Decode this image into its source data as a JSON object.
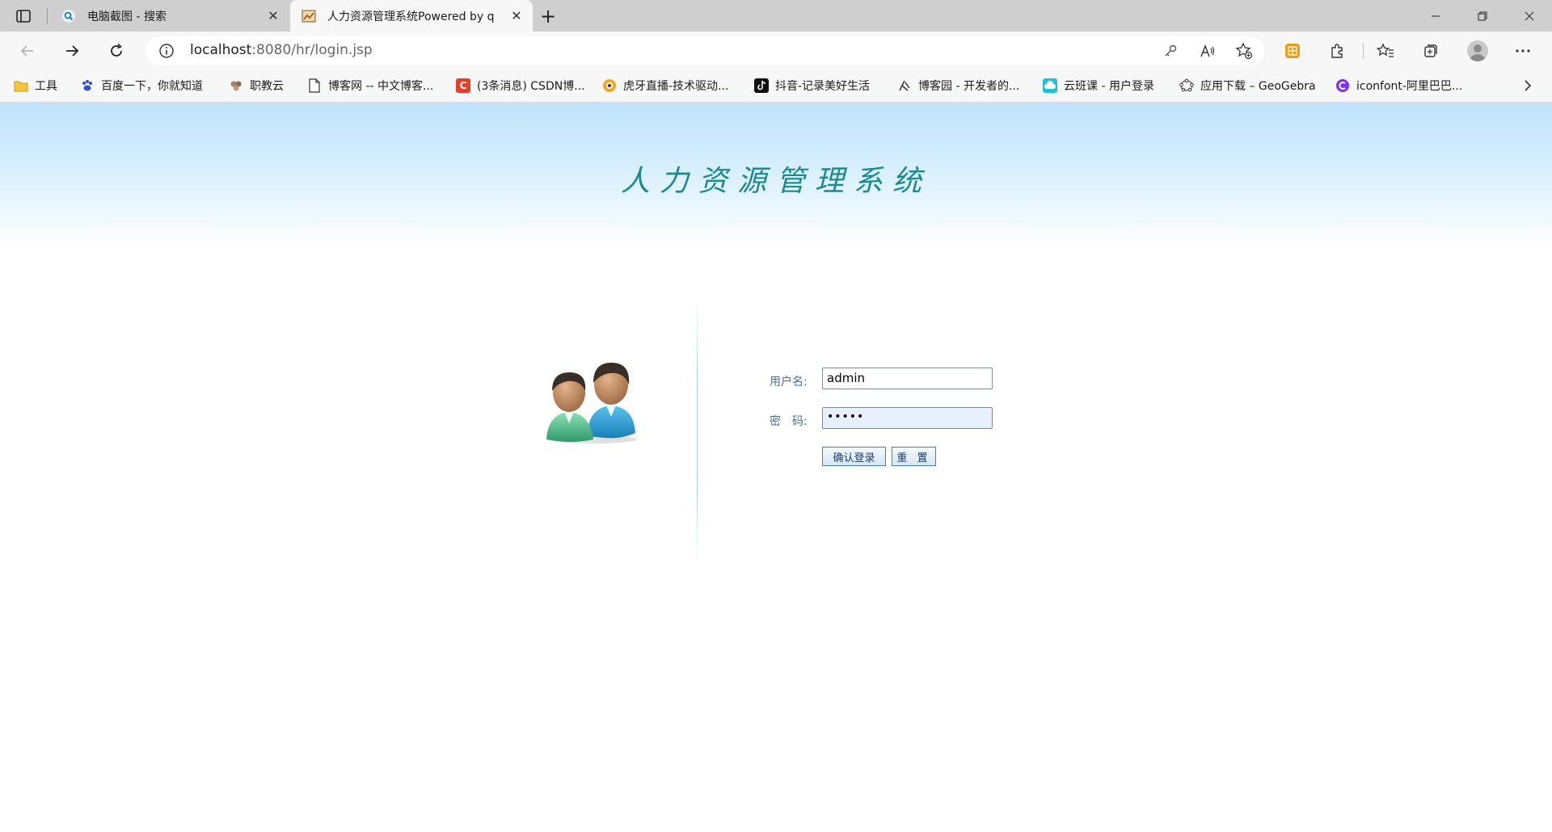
{
  "browser": {
    "tabs": [
      {
        "title": "电脑截图 - 搜索",
        "active": false,
        "icon": "search-favicon"
      },
      {
        "title": "人力资源管理系统Powered by q",
        "active": true,
        "icon": "app-favicon"
      }
    ],
    "address": {
      "host": "localhost",
      "path": ":8080/hr/login.jsp"
    },
    "bookmarks": [
      {
        "label": "工具",
        "icon": "folder-icon"
      },
      {
        "label": "百度一下，你就知道",
        "icon": "baidu-icon"
      },
      {
        "label": "职教云",
        "icon": "zhijiaoyun-icon"
      },
      {
        "label": "博客网 -- 中文博客...",
        "icon": "page-icon"
      },
      {
        "label": "(3条消息) CSDN博...",
        "icon": "csdn-icon"
      },
      {
        "label": "虎牙直播-技术驱动...",
        "icon": "huya-icon"
      },
      {
        "label": "抖音-记录美好生活",
        "icon": "douyin-icon"
      },
      {
        "label": "博客园 - 开发者的...",
        "icon": "cnblogs-icon"
      },
      {
        "label": "云班课 - 用户登录",
        "icon": "yunbanke-icon"
      },
      {
        "label": "应用下载 – GeoGebra",
        "icon": "geogebra-icon"
      },
      {
        "label": "iconfont-阿里巴巴...",
        "icon": "iconfont-icon"
      }
    ]
  },
  "page": {
    "title": "人力资源管理系统",
    "form": {
      "username_label": "用户名:",
      "username_value": "admin",
      "password_label": "密　码:",
      "password_value": "•••••",
      "login_button": "确认登录",
      "reset_button": "重 置"
    }
  },
  "colors": {
    "title": "#1a8a8e",
    "label": "#4a6f99",
    "header_gradient_top": "#bfe3fb"
  }
}
